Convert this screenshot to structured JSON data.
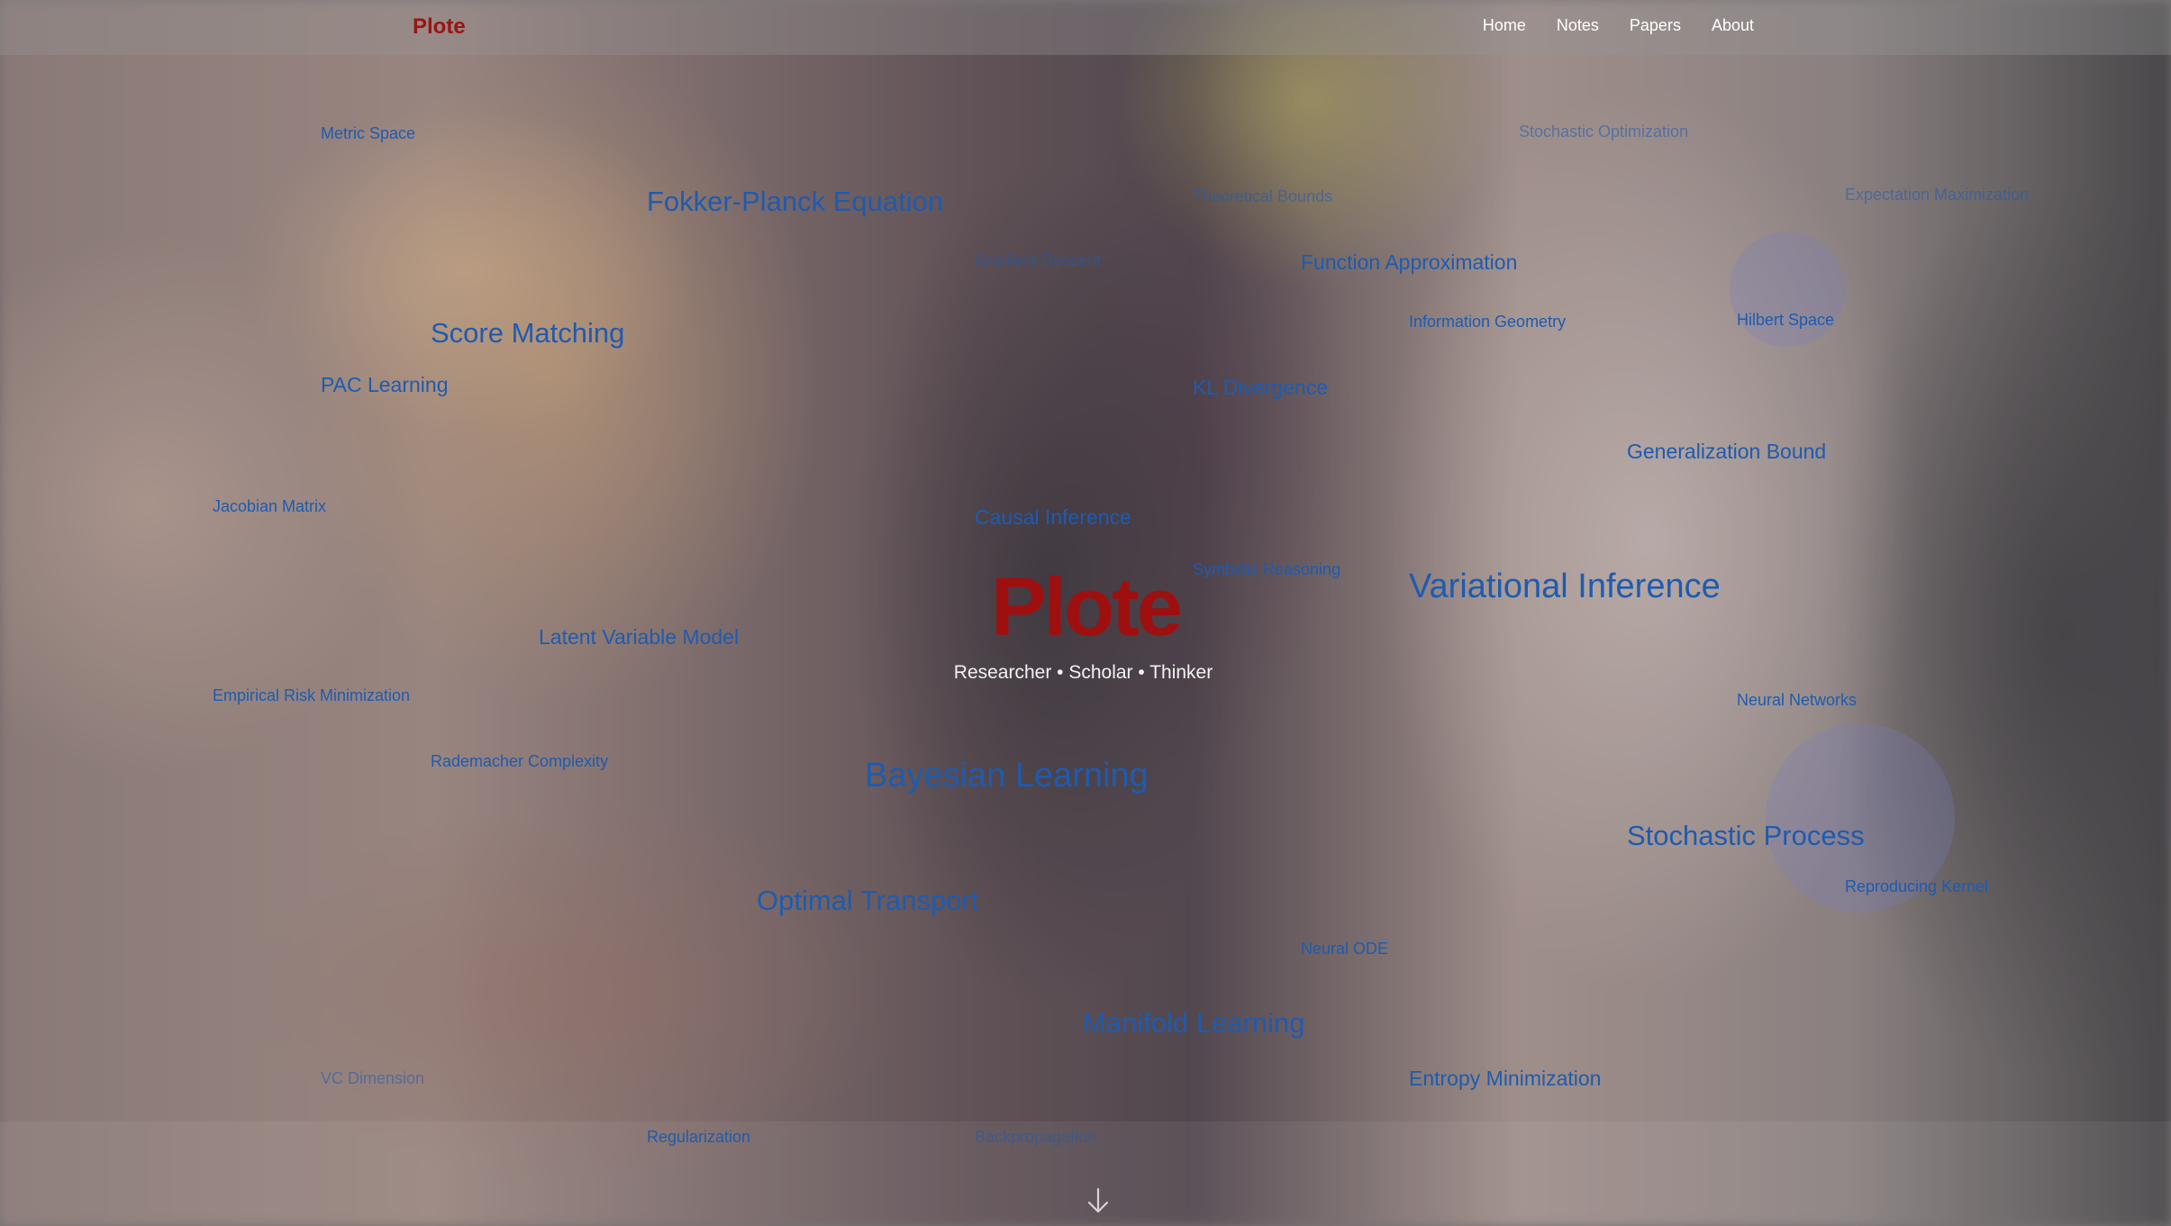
{
  "nav": {
    "brand": "Plote",
    "links": [
      "Home",
      "Notes",
      "Papers",
      "About"
    ]
  },
  "hero": {
    "title": "Plote",
    "subtitle": "Researcher • Scholar • Thinker"
  },
  "terms": [
    "Metric Space",
    "Stochastic Optimization",
    "Fokker-Planck Equation",
    "Theoretical Bounds",
    "Expectation Maximization",
    "Gradient Descent",
    "Function Approximation",
    "Score Matching",
    "Information Geometry",
    "Hilbert Space",
    "PAC Learning",
    "KL Divergence",
    "Generalization Bound",
    "Jacobian Matrix",
    "Causal Inference",
    "Symbolic Reasoning",
    "Variational Inference",
    "Latent Variable Model",
    "Empirical Risk Minimization",
    "Neural Networks",
    "Rademacher Complexity",
    "Bayesian Learning",
    "Stochastic Process",
    "Reproducing Kernel",
    "Optimal Transport",
    "Neural ODE",
    "Manifold Learning",
    "VC Dimension",
    "Entropy Minimization",
    "Regularization",
    "Backpropagation"
  ],
  "icons": {
    "scroll": "arrow-down-icon"
  },
  "colors": {
    "brand": "#9b1414",
    "term": "#1e5bb0",
    "nav_text": "#ffffff"
  }
}
